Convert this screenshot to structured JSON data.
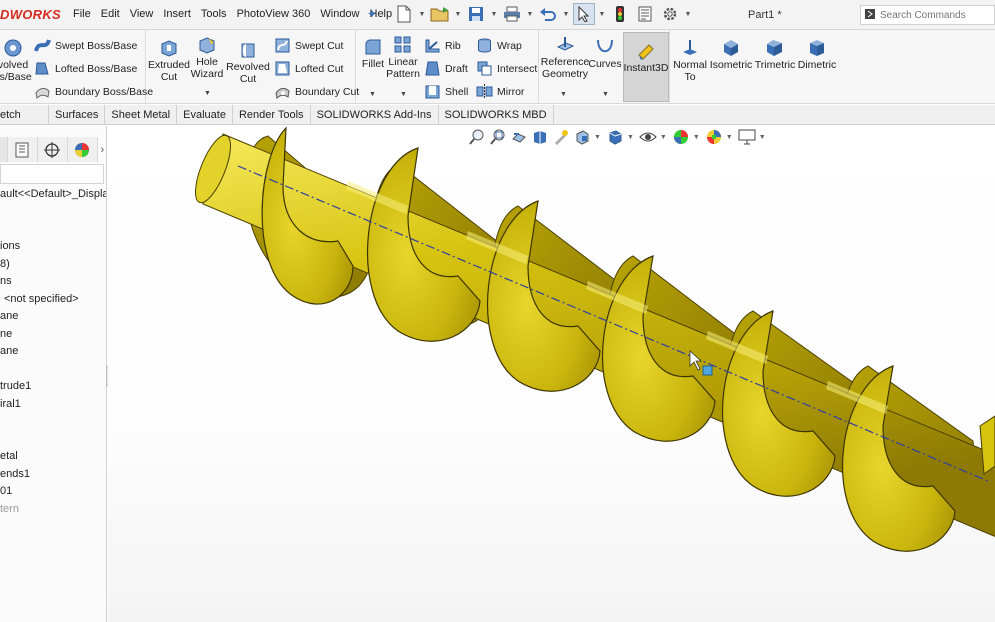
{
  "app": {
    "logo_text": "DWORKS",
    "document_title": "Part1 *"
  },
  "menu": [
    "File",
    "Edit",
    "View",
    "Insert",
    "Tools",
    "PhotoView 360",
    "Window",
    "Help"
  ],
  "search": {
    "placeholder": "Search Commands"
  },
  "ribbon": {
    "revolved": [
      "volved",
      "ss/Base"
    ],
    "swept_boss": "Swept Boss/Base",
    "lofted_boss": "Lofted Boss/Base",
    "boundary_boss": "Boundary Boss/Base",
    "extruded_cut": [
      "Extruded",
      "Cut"
    ],
    "hole_wizard": [
      "Hole",
      "Wizard"
    ],
    "revolved_cut": [
      "Revolved",
      "Cut"
    ],
    "swept_cut": "Swept Cut",
    "lofted_cut": "Lofted Cut",
    "boundary_cut": "Boundary Cut",
    "fillet": "Fillet",
    "linear_pattern": [
      "Linear",
      "Pattern"
    ],
    "rib": "Rib",
    "draft": "Draft",
    "shell": "Shell",
    "wrap": "Wrap",
    "intersect": "Intersect",
    "mirror": "Mirror",
    "reference_geometry": [
      "Reference",
      "Geometry"
    ],
    "curves": "Curves",
    "instant3d": "Instant3D",
    "normal_to": [
      "Normal",
      "To"
    ],
    "isometric": "Isometric",
    "trimetric": "Trimetric",
    "dimetric": "Dimetric"
  },
  "tabs": [
    "etch",
    "Surfaces",
    "Sheet Metal",
    "Evaluate",
    "Render Tools",
    "SOLIDWORKS Add-Ins",
    "SOLIDWORKS MBD"
  ],
  "tree": [
    "ault<<Default>_Displa",
    "ions",
    "8)",
    "ns",
    "<not specified>",
    "ane",
    "ne",
    "ane",
    "trude1",
    "iral1",
    "etal",
    "ends1",
    "01",
    "tern"
  ],
  "colors": {
    "accent": "#d52b1e",
    "model": "#d8c40e",
    "axis": "#2e3fa0",
    "selection_blue": "#4a79b5"
  }
}
